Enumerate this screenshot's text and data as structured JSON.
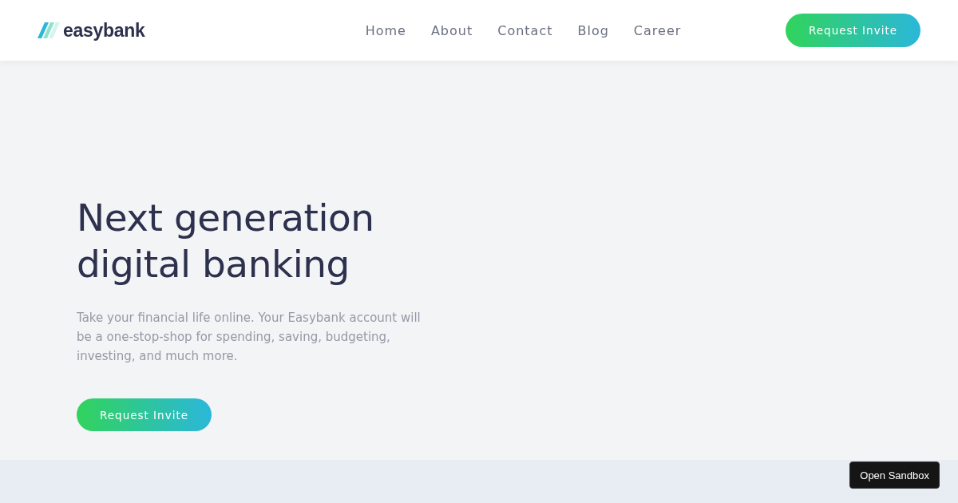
{
  "header": {
    "logo": "easybank",
    "nav": [
      {
        "label": "Home"
      },
      {
        "label": "About"
      },
      {
        "label": "Contact"
      },
      {
        "label": "Blog"
      },
      {
        "label": "Career"
      }
    ],
    "cta": "Request Invite"
  },
  "hero": {
    "title_lines": [
      "Next generation",
      "digital banking"
    ],
    "text": "Take your financial life online. Your Easybank account will be a one-stop-shop for spending, saving, budgeting, investing, and much more.",
    "cta": "Request Invite"
  },
  "sandbox_button": "Open Sandbox"
}
